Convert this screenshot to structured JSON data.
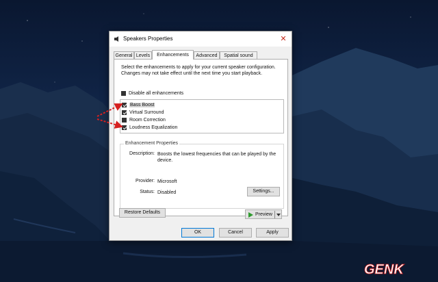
{
  "window": {
    "title": "Speakers Properties",
    "close_glyph": "✕"
  },
  "tabs": [
    {
      "label": "General",
      "active": false
    },
    {
      "label": "Levels",
      "active": false
    },
    {
      "label": "Enhancements",
      "active": true
    },
    {
      "label": "Advanced",
      "active": false
    },
    {
      "label": "Spatial sound",
      "active": false
    }
  ],
  "enhancements": {
    "intro": "Select the enhancements to apply for your current speaker configuration. Changes may not take effect until the next time you start playback.",
    "disable_all_label": "Disable all enhancements",
    "disable_all_checked": false,
    "items": [
      {
        "label": "Bass Boost",
        "checked": true,
        "selected": true
      },
      {
        "label": "Virtual Surround",
        "checked": true,
        "selected": false
      },
      {
        "label": "Room Correction",
        "checked": false,
        "selected": false
      },
      {
        "label": "Loudness Equalization",
        "checked": true,
        "selected": false
      }
    ]
  },
  "properties": {
    "group_title": "Enhancement Properties",
    "description_label": "Description:",
    "description_value": "Boosts the lowest frequencies that can be played by the device.",
    "provider_label": "Provider:",
    "provider_value": "Microsoft",
    "status_label": "Status:",
    "status_value": "Disabled",
    "settings_button": "Settings..."
  },
  "buttons": {
    "restore_defaults": "Restore Defaults",
    "preview": "Preview",
    "ok": "OK",
    "cancel": "Cancel",
    "apply": "Apply"
  },
  "watermark": {
    "text": "GENK"
  },
  "colors": {
    "arrow": "#d62020",
    "accent": "#0078d7",
    "play": "#2e9a2e"
  },
  "icons": {
    "title_icon": "speaker-icon",
    "preview_icon": "play-icon"
  }
}
